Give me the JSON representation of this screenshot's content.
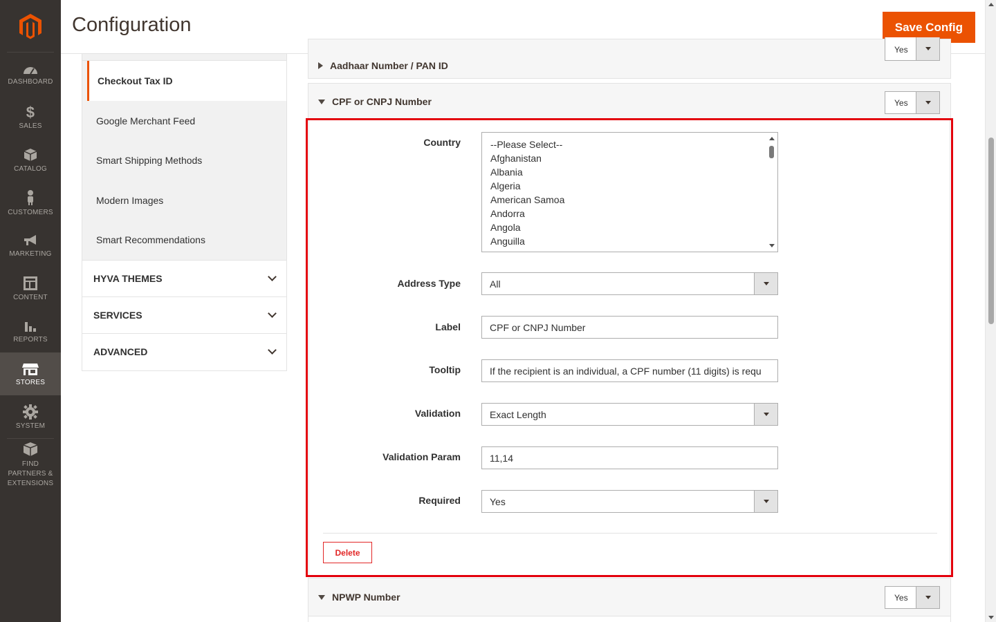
{
  "header": {
    "title": "Configuration",
    "save_label": "Save Config"
  },
  "nav": {
    "items": [
      {
        "label": "DASHBOARD",
        "icon": "dashboard-icon"
      },
      {
        "label": "SALES",
        "icon": "dollar-icon"
      },
      {
        "label": "CATALOG",
        "icon": "cube-icon"
      },
      {
        "label": "CUSTOMERS",
        "icon": "person-icon"
      },
      {
        "label": "MARKETING",
        "icon": "megaphone-icon"
      },
      {
        "label": "CONTENT",
        "icon": "layout-icon"
      },
      {
        "label": "REPORTS",
        "icon": "bar-chart-icon"
      },
      {
        "label": "STORES",
        "icon": "store-icon"
      },
      {
        "label": "SYSTEM",
        "icon": "gear-icon"
      },
      {
        "label": "FIND PARTNERS & EXTENSIONS",
        "icon": "box-icon"
      }
    ],
    "active": "STORES"
  },
  "config_tabs": {
    "items": [
      {
        "label": "Checkout Tax ID",
        "active": true
      },
      {
        "label": "Google Merchant Feed"
      },
      {
        "label": "Smart Shipping Methods"
      },
      {
        "label": "Modern Images"
      },
      {
        "label": "Smart Recommendations"
      }
    ],
    "groups": [
      {
        "label": "HYVA THEMES"
      },
      {
        "label": "SERVICES"
      },
      {
        "label": "ADVANCED"
      }
    ]
  },
  "sections": [
    {
      "title": "Aadhaar Number / PAN ID",
      "value": "Yes",
      "expanded": false
    },
    {
      "title": "CPF or CNPJ Number",
      "value": "Yes",
      "expanded": true
    },
    {
      "title": "NPWP Number",
      "value": "Yes",
      "expanded": true
    }
  ],
  "form": {
    "country": {
      "label": "Country",
      "options": [
        "--Please Select--",
        "Afghanistan",
        "Albania",
        "Algeria",
        "American Samoa",
        "Andorra",
        "Angola",
        "Anguilla"
      ]
    },
    "address_type": {
      "label": "Address Type",
      "value": "All"
    },
    "field_label": {
      "label": "Label",
      "value": "CPF or CNPJ Number"
    },
    "tooltip": {
      "label": "Tooltip",
      "value": "If the recipient is an individual, a CPF number (11 digits) is requ"
    },
    "validation": {
      "label": "Validation",
      "value": "Exact Length"
    },
    "validation_param": {
      "label": "Validation Param",
      "value": "11,14"
    },
    "required": {
      "label": "Required",
      "value": "Yes"
    },
    "delete_label": "Delete"
  },
  "colors": {
    "accent": "#eb5202",
    "nav_bg": "#373330",
    "highlight": "#e3000b",
    "danger": "#e22626"
  }
}
